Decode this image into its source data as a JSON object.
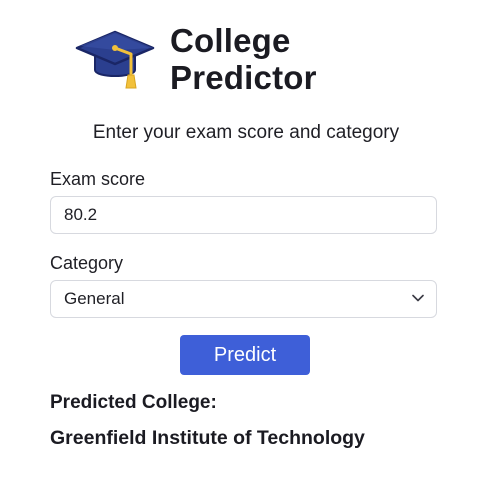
{
  "app": {
    "title": "College\nPredictor",
    "logo_icon": "graduation-cap-icon",
    "subtitle": "Enter your exam score and category"
  },
  "form": {
    "score_label": "Exam score",
    "score_value": "80.2",
    "category_label": "Category",
    "category_selected": "General",
    "category_chevron_icon": "chevron-down-icon",
    "submit_label": "Predict"
  },
  "result": {
    "label": "Predicted College:",
    "value": "Greenfield Institute of Technology"
  },
  "colors": {
    "accent": "#3e5fd8",
    "cap": "#2b3f8f",
    "tassel": "#f2c13b",
    "text": "#1b1b22",
    "border": "#d7d9df"
  }
}
